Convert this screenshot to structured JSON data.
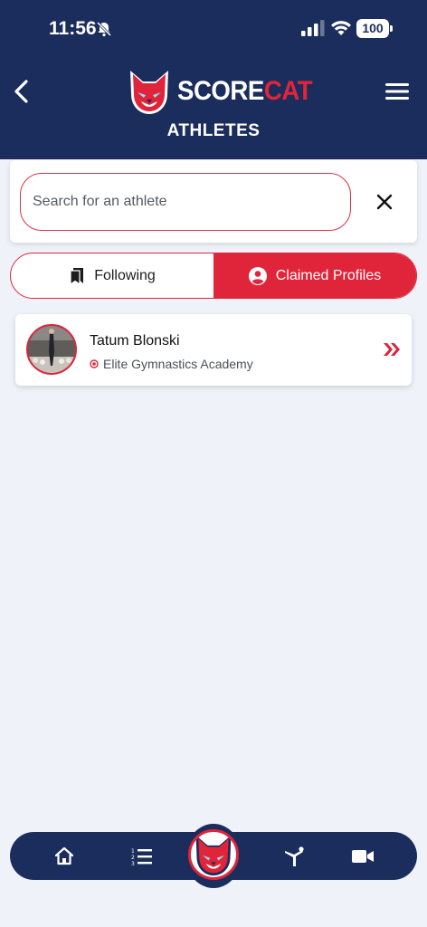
{
  "status_bar": {
    "time": "11:56",
    "battery": "100",
    "icons": [
      "bell-off-icon",
      "signal-icon",
      "wifi-icon",
      "battery-icon"
    ]
  },
  "header": {
    "logo_word_1": "SCORE",
    "logo_word_2": "CAT",
    "title": "ATHLETES",
    "back_icon": "chevron-left-icon",
    "menu_icon": "hamburger-menu-icon",
    "colors": {
      "navy": "#1b2d5c",
      "red": "#e0243a"
    }
  },
  "search": {
    "placeholder": "Search for an athlete",
    "value": "",
    "clear_icon": "close-icon"
  },
  "tabs": [
    {
      "label": "Following",
      "icon": "bookmark-icon",
      "active": false
    },
    {
      "label": "Claimed Profiles",
      "icon": "user-circle-icon",
      "active": true
    }
  ],
  "athletes": [
    {
      "name": "Tatum Blonski",
      "gym": "Elite Gymnastics Academy",
      "gym_icon": "location-dot-icon",
      "action_icon": "double-chevron-right-icon"
    }
  ],
  "bottom_nav": {
    "items": [
      "home-icon",
      "list-icon",
      "scorecat-logo",
      "gymnast-icon",
      "video-icon"
    ]
  }
}
